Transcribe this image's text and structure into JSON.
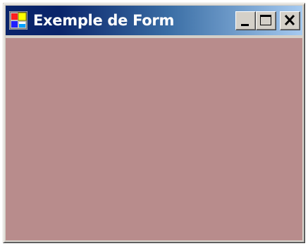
{
  "window": {
    "title": "Exemple de Form",
    "client_color": "#b88c8c",
    "titlebar_colors": [
      "#0a246a",
      "#a6caf0"
    ]
  },
  "icons": {
    "app": "form-app-icon",
    "minimize": "minimize-icon",
    "maximize": "maximize-icon",
    "close": "close-icon"
  }
}
